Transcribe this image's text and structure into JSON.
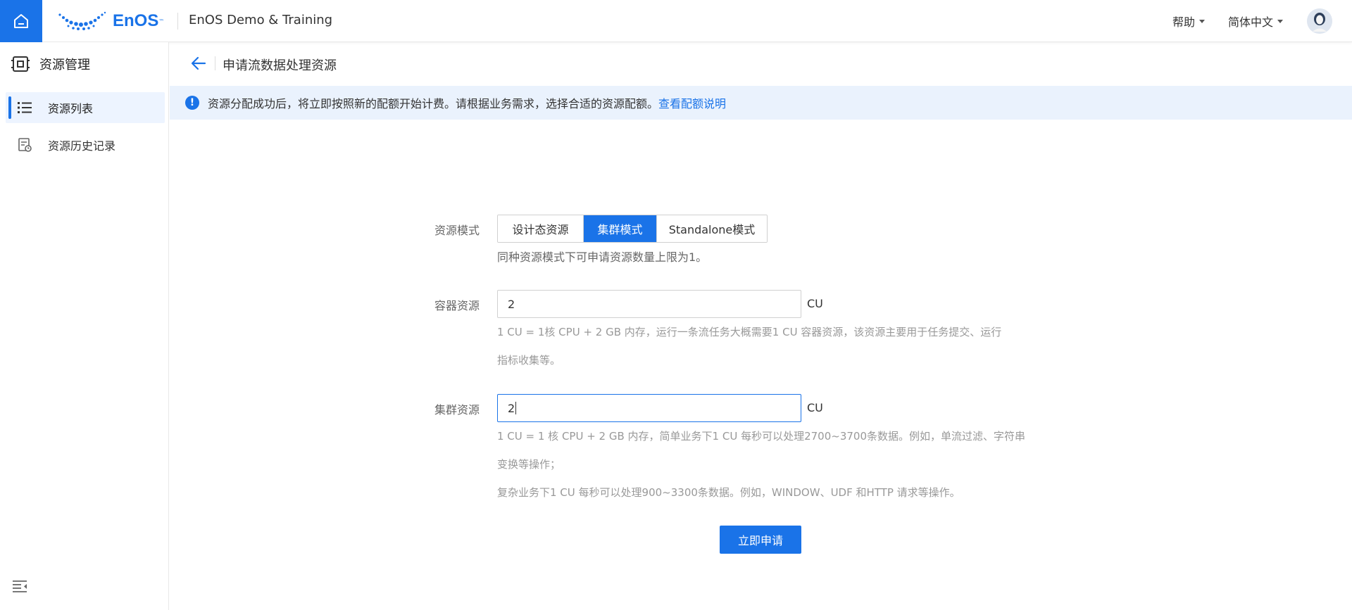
{
  "header": {
    "logo_text": "EnOS",
    "logo_tm": "™",
    "app_title": "EnOS Demo & Training",
    "help_label": "帮助",
    "language_label": "简体中文"
  },
  "sidebar": {
    "title": "资源管理",
    "items": [
      {
        "label": "资源列表",
        "icon": "list-icon",
        "active": true
      },
      {
        "label": "资源历史记录",
        "icon": "history-doc-icon",
        "active": false
      }
    ]
  },
  "page": {
    "title": "申请流数据处理资源",
    "alert_text": "资源分配成功后，将立即按照新的配额开始计费。请根据业务需求，选择合适的资源配额。",
    "alert_link": "查看配额说明"
  },
  "form": {
    "mode_label": "资源模式",
    "modes": [
      {
        "label": "设计态资源",
        "active": false
      },
      {
        "label": "集群模式",
        "active": true
      },
      {
        "label": "Standalone模式",
        "active": false
      }
    ],
    "mode_help": "同种资源模式下可申请资源数量上限为1。",
    "container_label": "容器资源",
    "container_value": "2",
    "container_unit": "CU",
    "container_help_1": "1 CU = 1核 CPU + 2 GB 内存，运行一条流任务大概需要1 CU 容器资源，该资源主要用于任务提交、运行",
    "container_help_2": "指标收集等。",
    "cluster_label": "集群资源",
    "cluster_value": "2",
    "cluster_unit": "CU",
    "cluster_help_1": "1 CU = 1 核 CPU + 2 GB 内存，简单业务下1 CU 每秒可以处理2700~3700条数据。例如，单流过滤、字符串",
    "cluster_help_2": "变换等操作；",
    "cluster_help_3": "复杂业务下1 CU 每秒可以处理900~3300条数据。例如，WINDOW、UDF 和HTTP 请求等操作。",
    "submit_label": "立即申请"
  },
  "colors": {
    "accent": "#1a73e8",
    "alert_bg": "#eaf2fd",
    "sidebar_active_bg": "#edf4ff"
  }
}
